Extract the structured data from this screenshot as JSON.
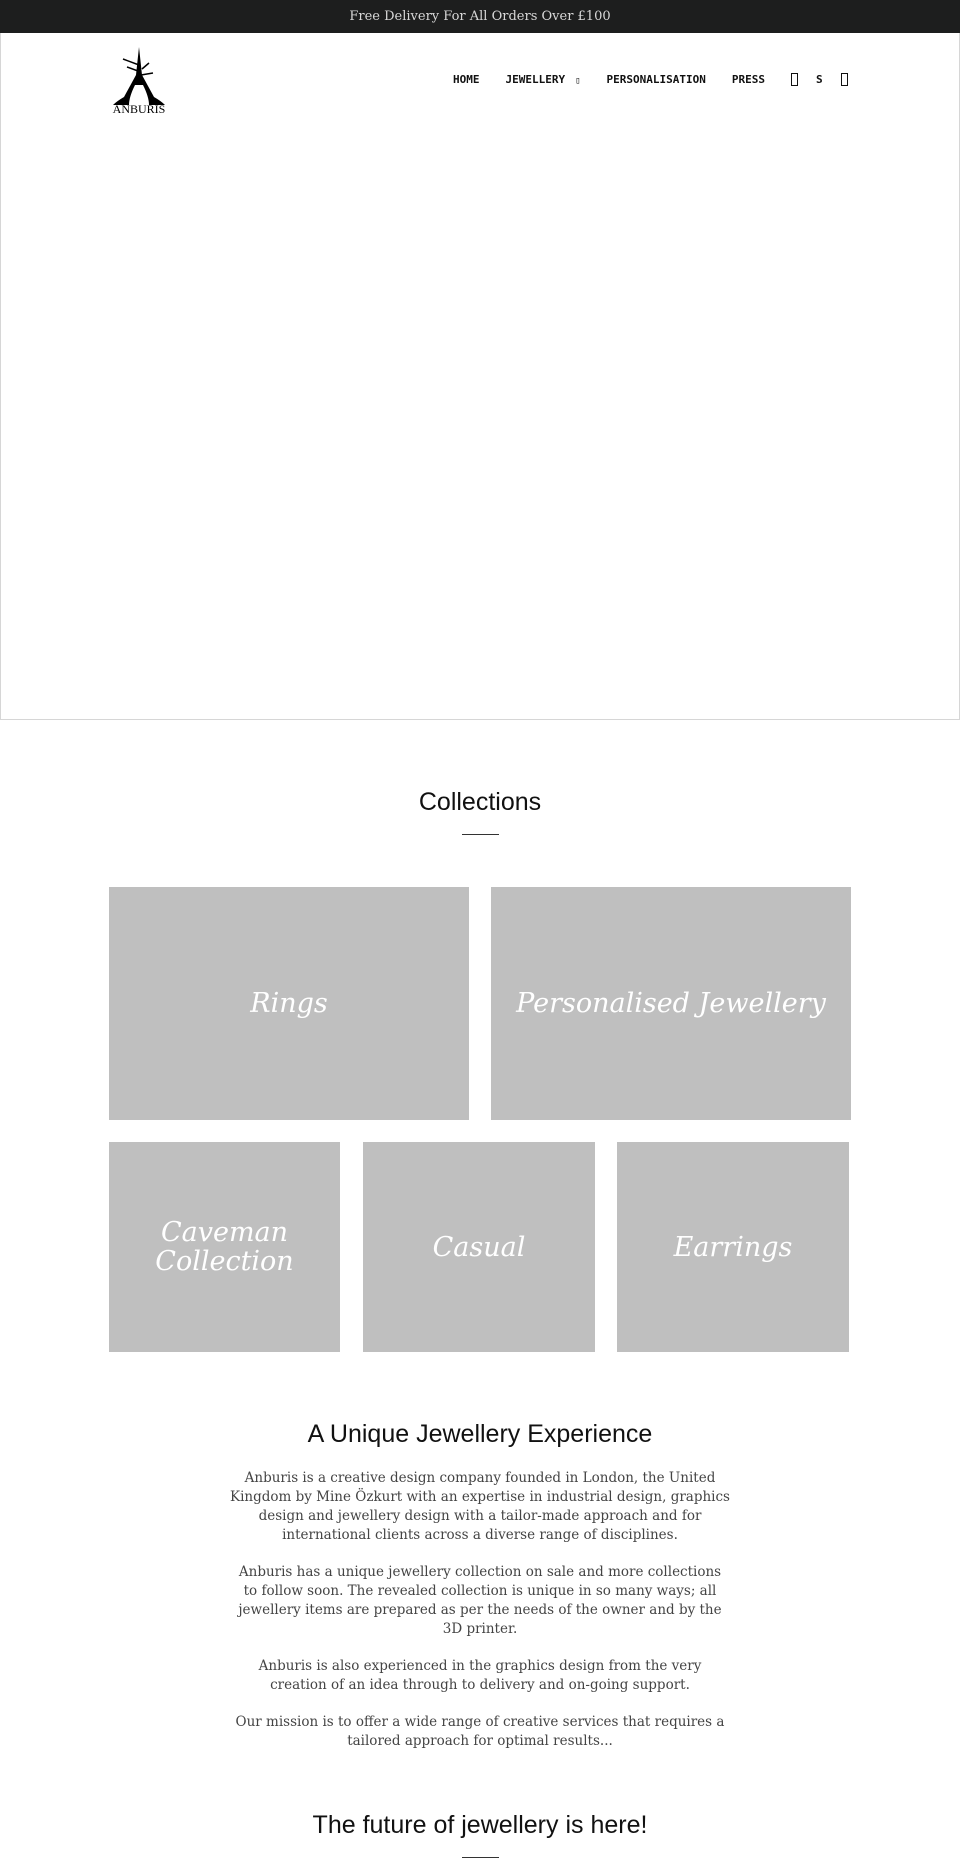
{
  "announcement": "Free Delivery For All Orders Over £100",
  "logo": {
    "text": "ANBURIS"
  },
  "nav": {
    "items": [
      "HOME",
      "JEWELLERY",
      "PERSONALISATION",
      "PRESS"
    ],
    "dropdown_glyph": "▯",
    "search_icon": "search-icon",
    "account_label": "S",
    "cart_icon": "cart-icon"
  },
  "collections": {
    "title": "Collections",
    "tiles": [
      "Rings",
      "Personalised Jewellery",
      "Caveman Collection",
      "Casual",
      "Earrings"
    ]
  },
  "about": {
    "title": "A Unique Jewellery Experience",
    "paragraphs": [
      "Anburis is a creative design company founded in London, the United Kingdom by Mine Özkurt with an expertise in industrial design, graphics design and jewellery design with a tailor-made approach and for international clients across a diverse range of disciplines.",
      "Anburis has a unique jewellery collection on sale and more collections to follow soon. The revealed collection is unique in so many ways; all jewellery items are prepared as per the needs of the owner and by the 3D printer.",
      "Anburis is also experienced in the graphics design from the very creation of an idea through to delivery and on-going support.",
      "Our mission is to offer a wide range of creative services that requires a tailored approach for optimal results..."
    ]
  },
  "future": {
    "title": "The future of jewellery is here!"
  },
  "colors": {
    "topbar": "#1d1e1e",
    "tile": "#bfbfbf"
  }
}
